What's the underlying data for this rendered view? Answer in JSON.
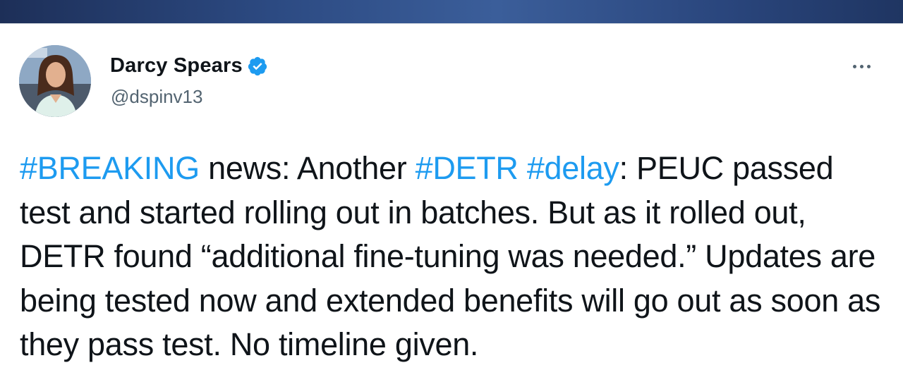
{
  "tweet": {
    "author": {
      "display_name": "Darcy Spears",
      "handle": "@dspinv13",
      "verified": true
    },
    "more_icon": "more-dots-icon",
    "segments": [
      {
        "type": "hashtag",
        "text": "#BREAKING"
      },
      {
        "type": "text",
        "text": " news: Another "
      },
      {
        "type": "hashtag",
        "text": "#DETR"
      },
      {
        "type": "text",
        "text": " "
      },
      {
        "type": "hashtag",
        "text": "#delay"
      },
      {
        "type": "text",
        "text": ": PEUC passed test and started rolling out in batches. But as it rolled out, DETR found “additional fine-tuning was needed.” Updates are being tested now and extended benefits will go out as soon as they pass test. No timeline given."
      }
    ]
  },
  "colors": {
    "hashtag": "#1d9bf0",
    "text": "#0f1419",
    "secondary": "#536471",
    "verified": "#1d9bf0"
  }
}
